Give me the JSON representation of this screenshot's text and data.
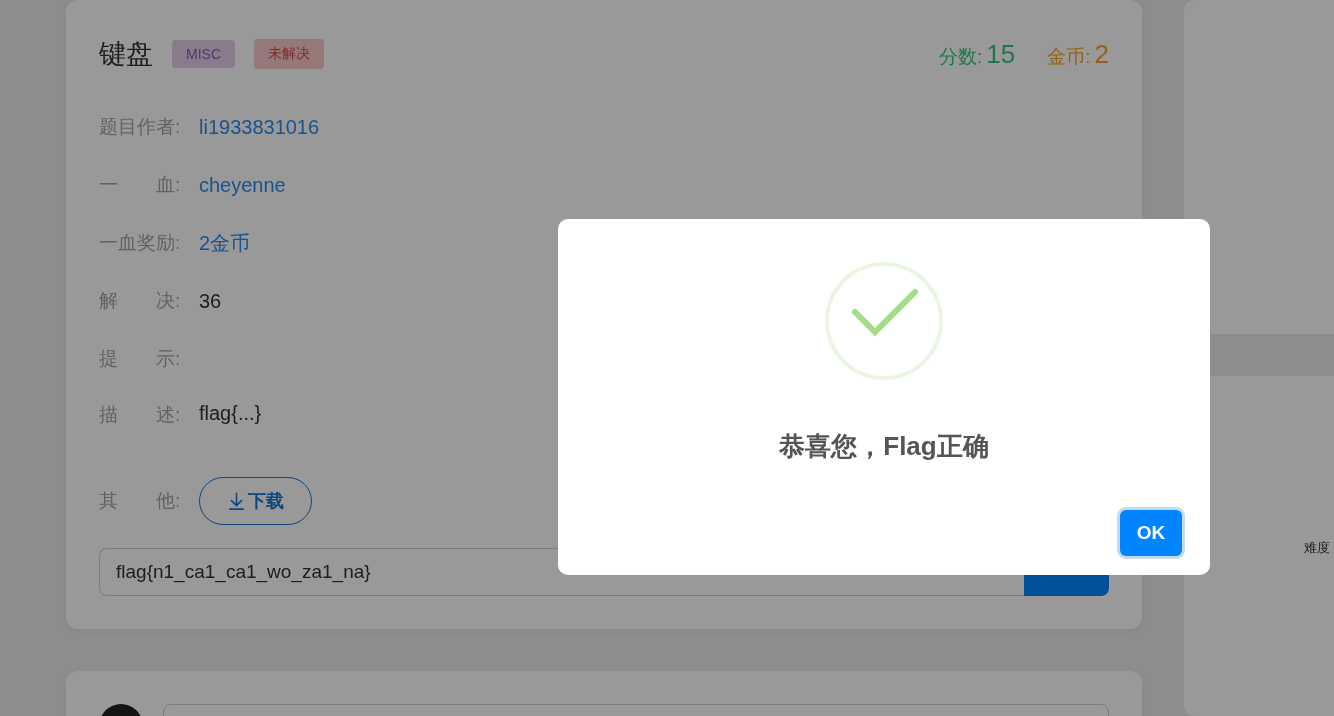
{
  "challenge": {
    "title": "键盘",
    "tags": [
      {
        "label": "MISC",
        "kind": "category"
      },
      {
        "label": "未解决",
        "kind": "status"
      }
    ],
    "score": {
      "label": "分数:",
      "value": "15"
    },
    "coins": {
      "label": "金币:",
      "value": "2"
    },
    "fields": [
      {
        "label": "题目作者:",
        "value": "li1933831016",
        "kind": "link"
      },
      {
        "label": "一　　血:",
        "value": "cheyenne",
        "kind": "link"
      },
      {
        "label": "一血奖励:",
        "value": "2金币",
        "kind": "link"
      },
      {
        "label": "解　　决:",
        "value": "36",
        "kind": "text"
      },
      {
        "label": "提　　示:",
        "kind": "text"
      },
      {
        "label": "描　　述:",
        "value": "flag{...}",
        "kind": "text"
      },
      {
        "label": "其　　他:",
        "button": "下载",
        "kind": "download"
      }
    ],
    "flag_input": {
      "value": "flag{n1_ca1_ca1_wo_za1_na}"
    }
  },
  "side_panel": {
    "label": "难度"
  },
  "modal": {
    "message": "恭喜您，Flag正确",
    "ok_button": "OK"
  }
}
